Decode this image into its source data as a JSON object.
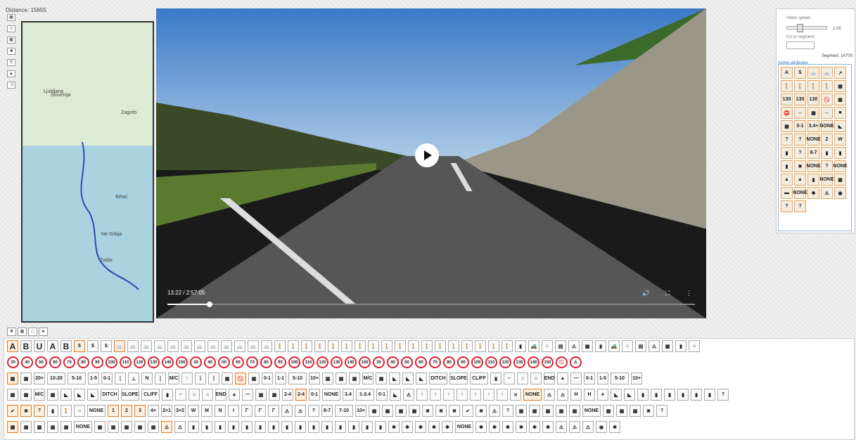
{
  "distance_text": "Distance: 15655",
  "side_tools": [
    "calendar-icon",
    "person-icon",
    "grid-icon",
    "camera-icon",
    "pin-icon",
    "bookmark-icon",
    "shuffle-icon"
  ],
  "map": {
    "labels": [
      "Ljubljana",
      "Slovenija",
      "Zagreb",
      "Bihać",
      "Ne-Srbija",
      "Zadar"
    ]
  },
  "video": {
    "time": "13:22 / 2:57:05",
    "progress": 0.08
  },
  "panel": {
    "video_speed_label": "Video speed:",
    "speed_value": "1.00",
    "speed_fraction": 0.25,
    "goto_label": "Go to segment:",
    "segment_text": "Segment: 14700",
    "active_legend": "Active attributes",
    "active_icons": [
      "A",
      "$",
      "🚲",
      "🚲",
      "↗",
      "🚶",
      "🚶",
      "🚶",
      "🚶",
      "▦",
      "130",
      "130",
      "130",
      "🚫",
      "▦",
      "⛔",
      "↔",
      "▦",
      "↔",
      "■",
      "▦",
      "0-1",
      "3.4+",
      "NONE",
      "◣",
      "?",
      "?",
      "NONE",
      "2",
      "W",
      "▮",
      "?",
      "8-7",
      "▮",
      "▮",
      "▮",
      "✖",
      "NONE",
      "?",
      "NONE",
      "▲",
      "▲",
      "▮",
      "NONE",
      "▦",
      "▬",
      "NONE",
      "✱",
      "⚠",
      "◉",
      "?",
      "?"
    ]
  },
  "toolbar": [
    "move-icon",
    "grid-icon",
    "box-icon",
    "star-icon"
  ],
  "palette_rows": [
    [
      "A",
      "B",
      "U",
      "A",
      "B",
      "$",
      "$",
      "$",
      "🚲",
      "🚲",
      "🚲",
      "🚲",
      "🚲",
      "🚲",
      "🚲",
      "🚲",
      "🚲",
      "🚲",
      "🚲",
      "🚲",
      "🚶",
      "🚶",
      "🚶",
      "🚶",
      "🚶",
      "🚶",
      "🚶",
      "🚶",
      "🚶",
      "🚶",
      "🚶",
      "🚶",
      "🚶",
      "🚶",
      "🚶",
      "🚶",
      "🚶",
      "🚶",
      "▮",
      "🚜",
      "⌂",
      "▤",
      "⚠",
      "▦",
      "▮",
      "🚜",
      "⌂",
      "▤",
      "⚠",
      "▦",
      "▮",
      "⌂"
    ],
    [
      "30",
      "40",
      "50",
      "60",
      "70",
      "80",
      "90",
      "100",
      "110",
      "120",
      "130",
      "140",
      "150",
      "30",
      "40",
      "50",
      "60",
      "70",
      "80",
      "90",
      "100",
      "110",
      "120",
      "130",
      "140",
      "150",
      "30",
      "40",
      "50",
      "60",
      "70",
      "80",
      "90",
      "100",
      "110",
      "120",
      "130",
      "140",
      "150",
      "🚫",
      "⚠"
    ],
    [
      "▦",
      "▦",
      "20+",
      "10-20",
      "5-10",
      "1-5",
      "0-1",
      "╎",
      "⊥",
      "N",
      "┆",
      "M/C",
      "↑",
      "|",
      "|",
      "▦",
      "🚫",
      "▦",
      "0-1",
      "1-1",
      "5-10",
      "10+",
      "▦",
      "▦",
      "▦",
      "M/C",
      "▦",
      "◣",
      "◣",
      "◣",
      "DITCH",
      "SLOPE",
      "CLIFF",
      "▮",
      "⌐",
      "⌂",
      "⌂",
      "END",
      "▲",
      "—",
      "0-1",
      "1-5",
      "5-10",
      "10+"
    ],
    [
      "▦",
      "▦",
      "M/C",
      "▦",
      "◣",
      "◣",
      "◣",
      "DITCH",
      "SLOPE",
      "CLIFF",
      "▮",
      "⌐",
      "⌂",
      "⌂",
      "END",
      "▲",
      "—",
      "▦",
      "▦",
      "2-4",
      "2-4",
      "0-1",
      "NONE",
      "3.4",
      "1-3.4",
      "0-1",
      "◣",
      "⚠",
      "↑",
      "↑",
      "↑",
      "↑",
      "↑",
      "↑",
      "↑",
      "✕",
      "NONE",
      "⚠",
      "⚠",
      "H",
      "H",
      "●",
      "◣",
      "◣",
      "▮",
      "▮",
      "▮",
      "▮",
      "▮",
      "▮",
      "?"
    ],
    [
      "✔",
      "✖",
      "?",
      "▮",
      "🚶",
      "⌂",
      "NONE",
      "1",
      "2",
      "3",
      "4+",
      "2+1",
      "3+2",
      "W",
      "M",
      "N",
      "I",
      "Γ",
      "Γ",
      "Γ",
      "⚠",
      "⚠",
      "?",
      "8-7",
      "7-10",
      "10+",
      "▦",
      "▦",
      "▦",
      "▦",
      "✖",
      "✖",
      "✖",
      "✔",
      "✖",
      "⚠",
      "?",
      "▦",
      "▦",
      "▦",
      "▦",
      "▦",
      "NONE",
      "▦",
      "▦",
      "▦",
      "✖",
      "?"
    ],
    [
      "▦",
      "▦",
      "▦",
      "▦",
      "▦",
      "NONE",
      "▦",
      "▦",
      "▦",
      "▦",
      "▦",
      "⚠",
      "⚠",
      "▮",
      "▮",
      "▮",
      "▮",
      "▮",
      "▮",
      "▮",
      "▮",
      "▮",
      "▮",
      "▮",
      "▮",
      "▮",
      "▮",
      "▮",
      "✱",
      "✱",
      "✱",
      "✱",
      "✱",
      "NONE",
      "✱",
      "✱",
      "✱",
      "✱",
      "✱",
      "✱",
      "⚠",
      "⚠",
      "⚠",
      "◉",
      "✱"
    ]
  ]
}
